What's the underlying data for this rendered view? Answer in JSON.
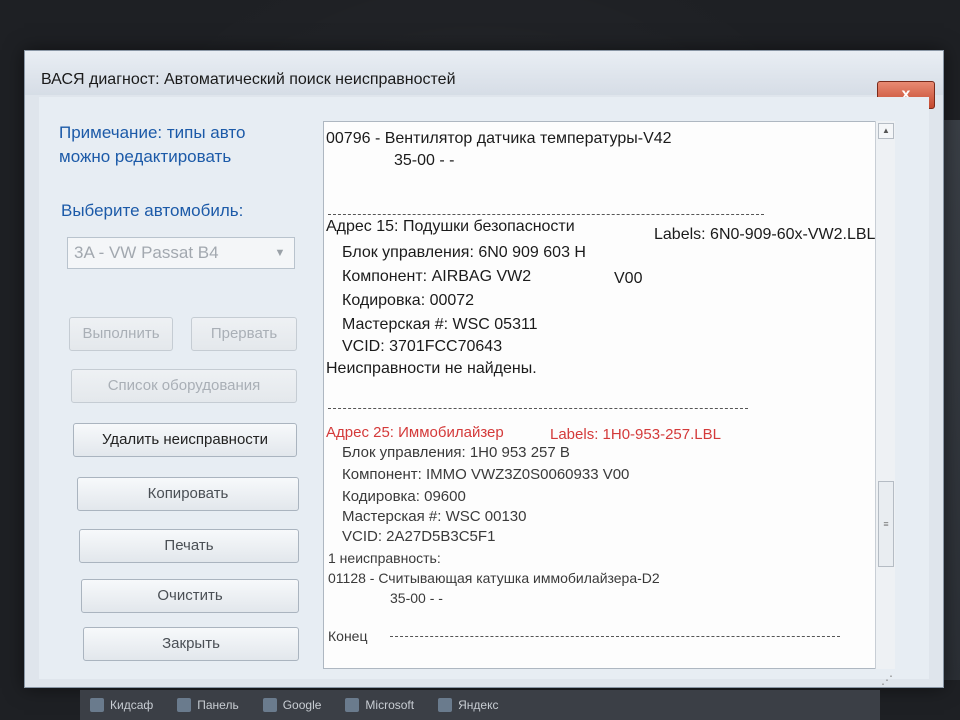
{
  "window": {
    "title": "ВАСЯ диагност: Автоматический поиск неисправностей",
    "close_symbol": "x"
  },
  "left_panel": {
    "note_line1": "Примечание: типы авто",
    "note_line2": "можно редактировать",
    "choose_label": "Выберите автомобиль:",
    "car_select_value": "3A - VW Passat B4",
    "buttons": {
      "run": "Выполнить",
      "stop": "Прервать",
      "equipment_list": "Список оборудования",
      "clear_faults": "Удалить неисправности",
      "copy": "Копировать",
      "print": "Печать",
      "clear": "Очистить",
      "close": "Закрыть"
    }
  },
  "report": {
    "block0": {
      "fault_line": "00796 -   Вентилятор датчика температуры-V42",
      "fault_sub": "35-00 -   -"
    },
    "block15": {
      "address": "Адрес 15:  Подушки безопасности",
      "labels": "Labels: 6N0-909-60x-VW2.LBL",
      "control_unit": "Блок управления: 6N0 909 603 H",
      "component": "Компонент: AIRBAG VW2",
      "component_ver": "V00",
      "coding": "Кодировка: 00072",
      "workshop": "Мастерская #: WSC 05311",
      "vcid": "VCID: 3701FCC70643",
      "status": "Неисправности не найдены."
    },
    "block25": {
      "address": "Адрес 25:  Иммобилайзер",
      "labels": "Labels:  1H0-953-257.LBL",
      "control_unit": "Блок управления: 1H0 953 257 B",
      "component": "Компонент: IMMO VWZ3Z0S0060933 V00",
      "coding": "Кодировка: 09600",
      "workshop": "Мастерская #: WSC 00130",
      "vcid": "VCID: 2A27D5B3C5F1",
      "fault_count": "1 неисправность:",
      "fault_line": "01128 -   Считывающая катушка иммобилайзера-D2",
      "fault_sub": "35-00 -   -"
    },
    "end_label": "Конец"
  },
  "taskbar": {
    "items": [
      "Кидсаф",
      "Панель",
      "Google",
      "Microsoft",
      "Яндекс"
    ]
  }
}
